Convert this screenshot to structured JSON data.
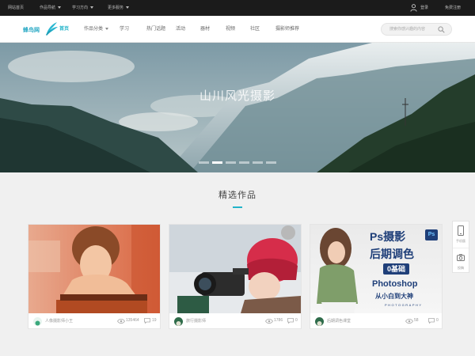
{
  "topbar": {
    "items": [
      {
        "label": "网站首页",
        "caret": false
      },
      {
        "label": "作品导航",
        "caret": true
      },
      {
        "label": "学习方向",
        "caret": true
      },
      {
        "label": "更多服务",
        "caret": true
      }
    ],
    "login_label": "登录",
    "register_label": "免费注册"
  },
  "nav": {
    "logo_text": "蜂鸟网",
    "items": [
      {
        "label": "首页",
        "active": true,
        "caret": false
      },
      {
        "label": "作品分类",
        "active": false,
        "caret": true
      },
      {
        "label": "学习",
        "active": false,
        "caret": false
      },
      {
        "label": "热门话题",
        "active": false,
        "caret": false
      },
      {
        "label": "活动",
        "active": false,
        "caret": false
      },
      {
        "label": "器材",
        "active": false,
        "caret": false
      },
      {
        "label": "视频",
        "active": false,
        "caret": false
      },
      {
        "label": "社区",
        "active": false,
        "caret": false
      },
      {
        "label": "摄影师推荐",
        "active": false,
        "caret": false
      }
    ],
    "search_placeholder": "搜索你感兴趣的内容"
  },
  "banner": {
    "title": "山川风光摄影",
    "slide_count": 6,
    "active_slide": 2
  },
  "section": {
    "title": "精选作品"
  },
  "cards": [
    {
      "author": "人像摄影师小王",
      "views": "135464",
      "comments": "19"
    },
    {
      "author": "旅行摄影师",
      "views": "1786",
      "comments": "0"
    },
    {
      "author": "后期调色课堂",
      "views": "58",
      "comments": "0"
    }
  ],
  "course_poster": {
    "line1": "Ps摄影",
    "badge": "Ps",
    "line2": "后期调色",
    "line3": "0基础",
    "line4": "Photoshop",
    "line5": "从小白到大神",
    "line6": "PHOTOGRAPHY"
  },
  "float_bar": {
    "items": [
      {
        "label": "手机版"
      },
      {
        "label": "投稿"
      }
    ]
  },
  "colors": {
    "accent": "#22b3c9",
    "topbar_bg": "#1b1b1b",
    "page_bg": "#f0f0f0"
  }
}
